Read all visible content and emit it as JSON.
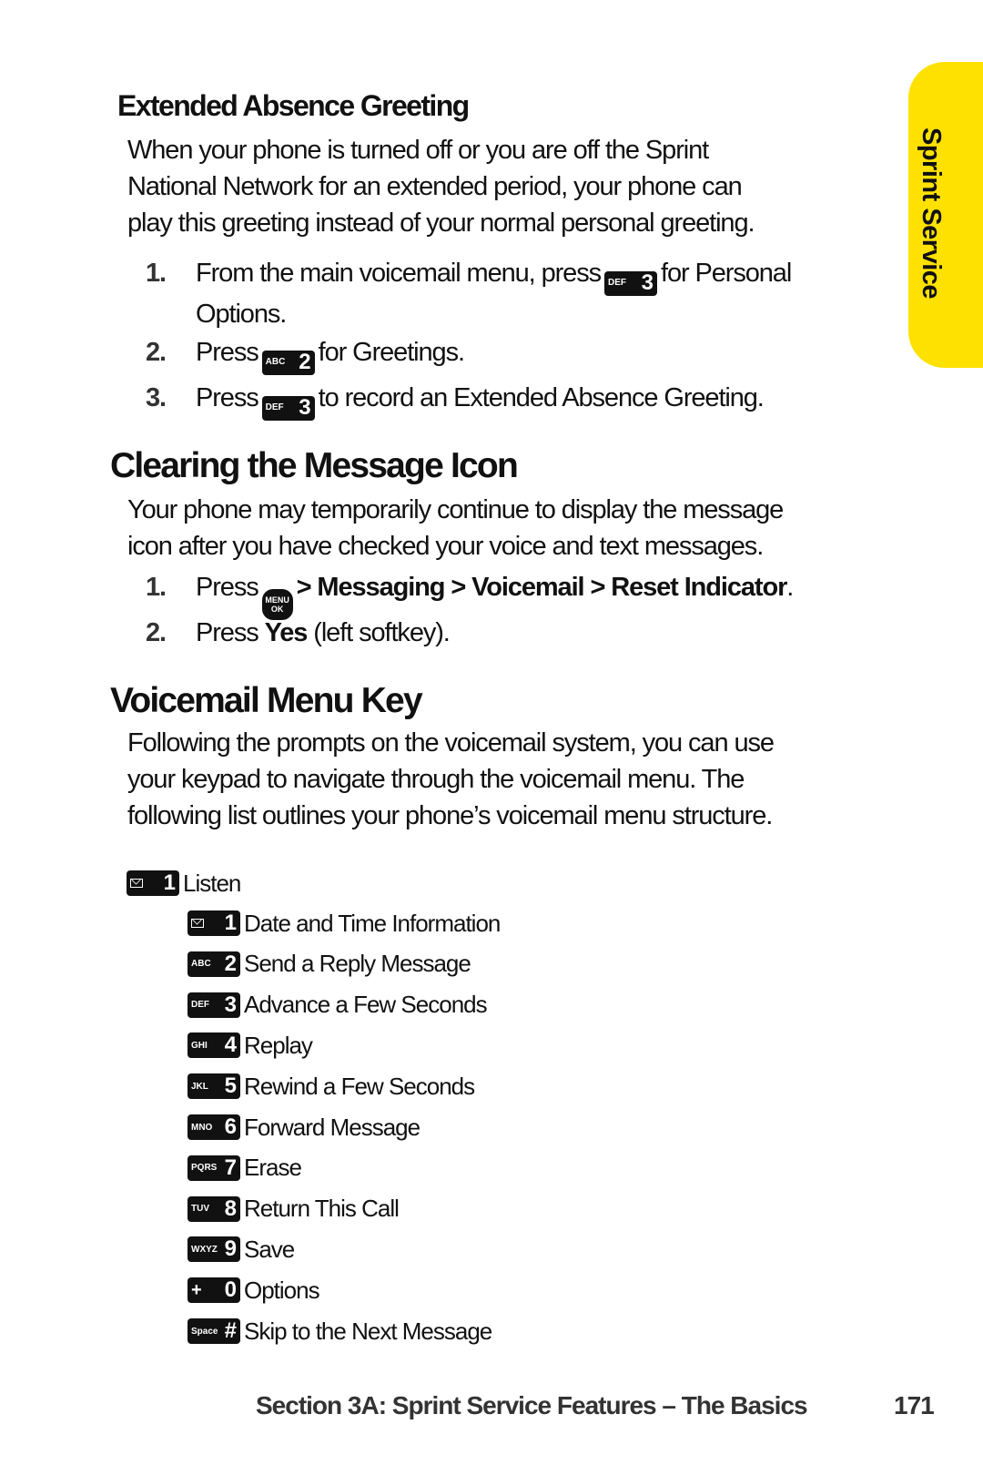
{
  "side_tab": {
    "label": "Sprint Service",
    "color": "#ffe100"
  },
  "extended_absence": {
    "heading": "Extended Absence Greeting",
    "intro_lines": [
      "When your phone is turned off or you are off the Sprint",
      "National Network for an extended period, your phone can",
      "play this greeting instead of your normal personal greeting."
    ],
    "steps": [
      {
        "num": "1.",
        "pre": "From the main voicemail menu, press",
        "key": {
          "letters": "DEF",
          "digit": "3"
        },
        "post": "for Personal",
        "line2": "Options."
      },
      {
        "num": "2.",
        "pre": "Press",
        "key": {
          "letters": "ABC",
          "digit": "2"
        },
        "post": "for Greetings."
      },
      {
        "num": "3.",
        "pre": "Press",
        "key": {
          "letters": "DEF",
          "digit": "3"
        },
        "post": "to record an Extended Absence Greeting."
      }
    ]
  },
  "clearing": {
    "heading": "Clearing the Message Icon",
    "intro_lines": [
      "Your phone may temporarily continue to display the message",
      "icon after you have checked your voice and text messages."
    ],
    "steps": [
      {
        "num": "1.",
        "pre": "Press",
        "key": {
          "top": "MENU",
          "bottom": "OK"
        },
        "path": "> Messaging > Voicemail > Reset Indicator",
        "end": "."
      },
      {
        "num": "2.",
        "pre": "Press",
        "bold": "Yes",
        "post": "(left softkey)."
      }
    ]
  },
  "menu_key": {
    "heading": "Voicemail Menu Key",
    "intro_lines": [
      "Following the prompts on the voicemail system, you can use",
      "your keypad to navigate through the voicemail menu. The",
      "following list outlines your phone’s voicemail menu structure."
    ],
    "top_item": {
      "key": {
        "letters": "mail",
        "digit": "1"
      },
      "label": "Listen"
    },
    "items": [
      {
        "key": {
          "letters": "mail",
          "digit": "1"
        },
        "label": "Date and Time Information"
      },
      {
        "key": {
          "letters": "ABC",
          "digit": "2"
        },
        "label": "Send a Reply Message"
      },
      {
        "key": {
          "letters": "DEF",
          "digit": "3"
        },
        "label": "Advance a Few Seconds"
      },
      {
        "key": {
          "letters": "GHI",
          "digit": "4"
        },
        "label": "Replay"
      },
      {
        "key": {
          "letters": "JKL",
          "digit": "5"
        },
        "label": "Rewind a Few Seconds"
      },
      {
        "key": {
          "letters": "MNO",
          "digit": "6"
        },
        "label": "Forward Message"
      },
      {
        "key": {
          "letters": "PQRS",
          "digit": "7"
        },
        "label": "Erase"
      },
      {
        "key": {
          "letters": "TUV",
          "digit": "8"
        },
        "label": "Return This Call"
      },
      {
        "key": {
          "letters": "WXYZ",
          "digit": "9"
        },
        "label": "Save"
      },
      {
        "key": {
          "letters": "+",
          "digit": "0"
        },
        "label": "Options"
      },
      {
        "key": {
          "letters": "Space",
          "digit": "#"
        },
        "label": "Skip to the Next Message"
      }
    ]
  },
  "footer": {
    "section": "Section 3A: Sprint Service Features – The Basics",
    "page_number": "171"
  }
}
